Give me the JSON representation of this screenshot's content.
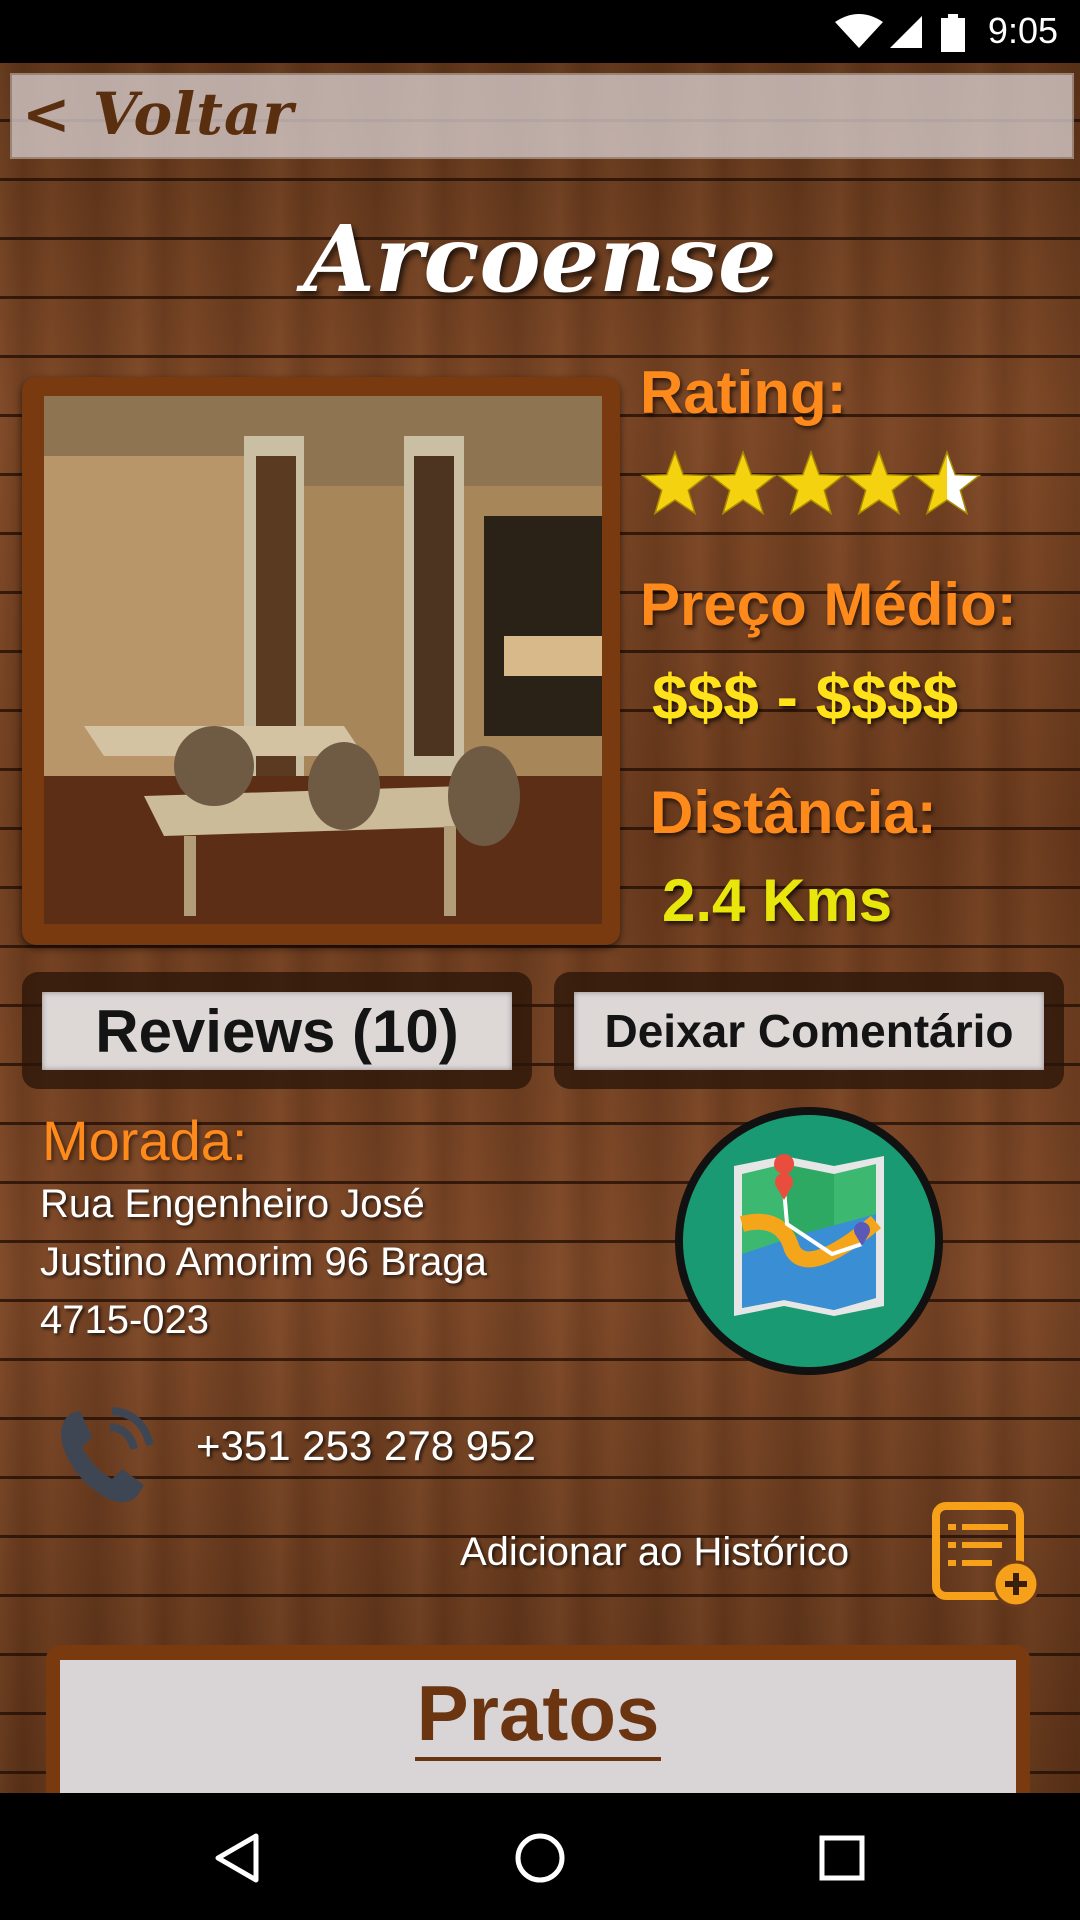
{
  "status_bar": {
    "time": "9:05",
    "icons": [
      "wifi-icon",
      "signal-icon",
      "battery-icon"
    ]
  },
  "header": {
    "back_label": "< Voltar"
  },
  "restaurant": {
    "name": "Arcoense",
    "rating_label": "Rating:",
    "rating_value": 4.5,
    "rating_max": 5,
    "price_label": "Preço Médio:",
    "price_value": "$$$ - $$$$",
    "distance_label": "Distância:",
    "distance_value": "2.4 Kms",
    "address_label": "Morada:",
    "address_lines": [
      "Rua Engenheiro José",
      "Justino Amorim 96 Braga",
      "4715-023"
    ],
    "phone": "+351 253 278 952"
  },
  "actions": {
    "reviews_label": "Reviews (10)",
    "comment_label": "Deixar Comentário",
    "add_history_label": "Adicionar ao Histórico",
    "map_icon": "map-icon",
    "phone_icon": "phone-icon",
    "history_icon": "add-history-icon"
  },
  "section": {
    "pratos_label": "Pratos"
  },
  "nav_bar": {
    "buttons": [
      "back-icon",
      "home-icon",
      "recents-icon"
    ]
  },
  "colors": {
    "accent_orange": "#ff8a1c",
    "accent_yellow": "#ffe21a",
    "frame_brown": "#7a3a10",
    "map_teal": "#1a9a73"
  }
}
